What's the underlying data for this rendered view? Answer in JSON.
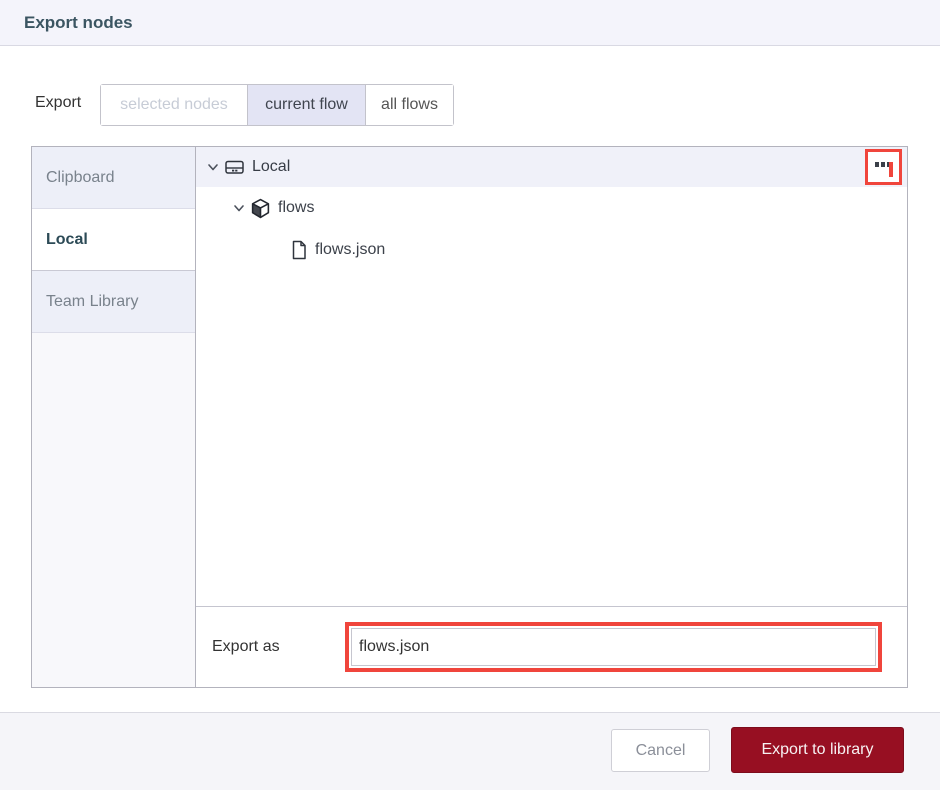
{
  "dialog": {
    "title": "Export nodes",
    "scope": {
      "label": "Export",
      "options": [
        {
          "label": "selected nodes",
          "state": "disabled"
        },
        {
          "label": "current flow",
          "state": "selected"
        },
        {
          "label": "all flows",
          "state": "normal"
        }
      ]
    },
    "sidebar": {
      "tabs": [
        {
          "label": "Clipboard",
          "selected": false
        },
        {
          "label": "Local",
          "selected": true
        },
        {
          "label": "Team Library",
          "selected": false
        }
      ]
    },
    "tree": {
      "root": {
        "label": "Local",
        "icon": "hard-drive-icon",
        "expanded": true
      },
      "folder": {
        "label": "flows",
        "icon": "cube-icon",
        "expanded": true
      },
      "file": {
        "label": "flows.json",
        "icon": "file-icon"
      }
    },
    "menu_button": {
      "icon": "ellipsis-icon",
      "highlighted": true
    },
    "export_as": {
      "label": "Export as",
      "value": "flows.json",
      "highlighted": true
    },
    "footer": {
      "cancel_label": "Cancel",
      "primary_label": "Export to library"
    },
    "colors": {
      "highlight_red": "#f0453c",
      "primary_button": "#970f22",
      "selected_scope_bg": "#e3e4f4",
      "header_bg": "#f4f4fb"
    }
  }
}
